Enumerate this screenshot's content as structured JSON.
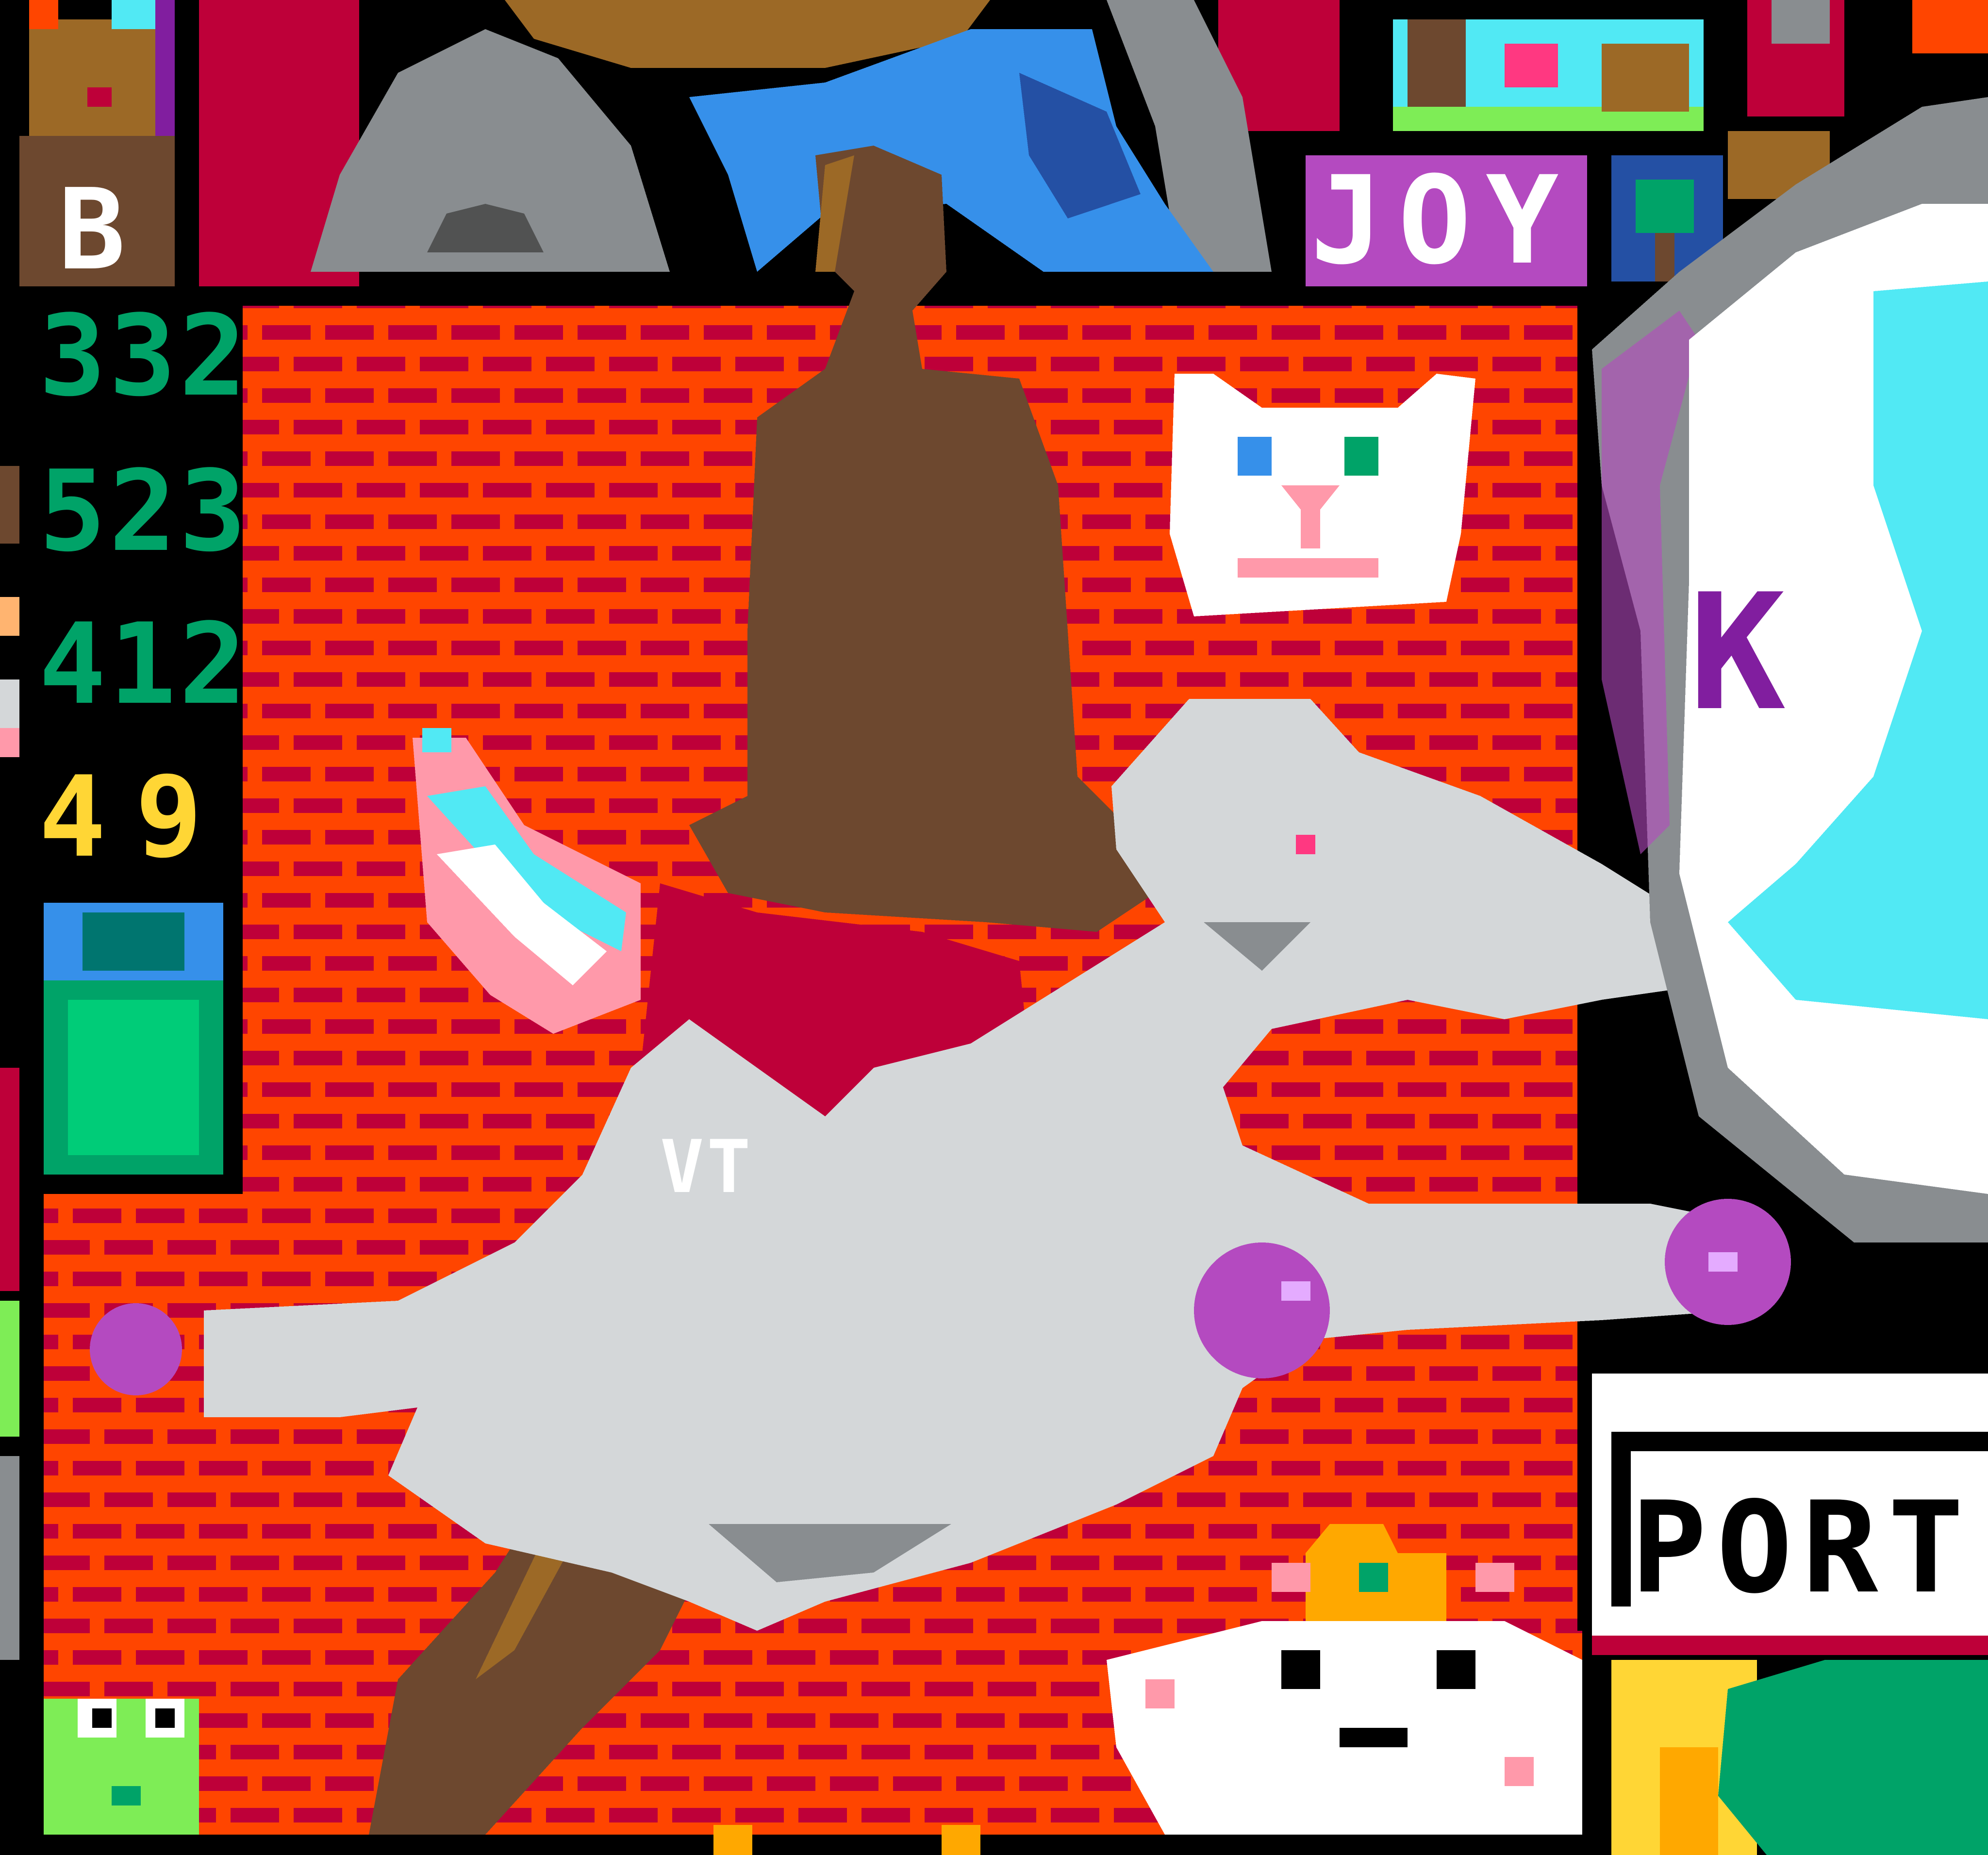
{
  "canvas": {
    "background": "#000000",
    "palette": {
      "brick_orange": "#FF4500",
      "brick_red": "#BE0039",
      "wolf_gray": "#D4D7D9",
      "dark_gray": "#898D90",
      "brown": "#6D482F",
      "tan": "#9C6926",
      "blue": "#3690EA",
      "dark_blue": "#2450A4",
      "purple": "#B44AC0",
      "dark_purple": "#811E9F",
      "light_purple": "#E4ABFF",
      "green": "#00A368",
      "light_green": "#7EED56",
      "teal": "#00756F",
      "cyan": "#51E9F4",
      "yellow": "#FFD635",
      "orange": "#FFA800",
      "white": "#FFFFFF",
      "pink": "#FF99AA",
      "black": "#000000"
    }
  },
  "labels": {
    "num_332": "332",
    "num_523": "523",
    "num_412": "412",
    "num_49": "49",
    "joy": "JOY",
    "port": "PORT",
    "letter_b": "B",
    "letter_k": "K",
    "vt": "VT"
  },
  "icons": {
    "cat": "white-cat-icon",
    "frog": "frog-icon",
    "crown_cat": "crown-cat-icon",
    "wolf": "gray-wolf-icon",
    "figure": "brown-figure-icon",
    "ice_cream": "trans-flag-ice-cream-icon",
    "orbs": "purple-orb-icon"
  }
}
